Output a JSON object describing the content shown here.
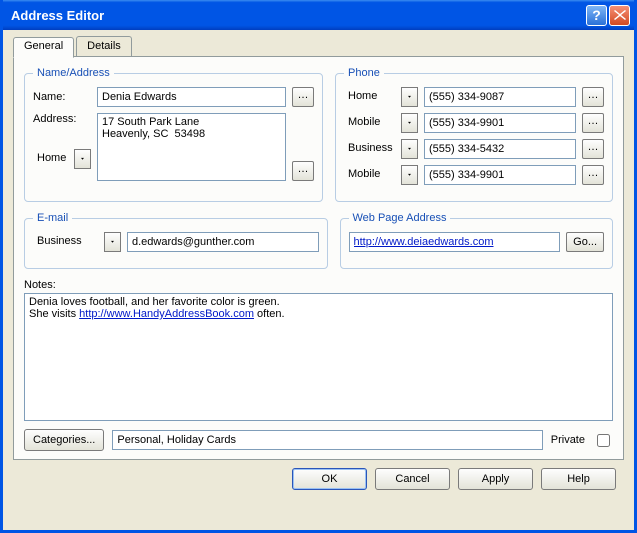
{
  "window": {
    "title": "Address Editor"
  },
  "tabs": {
    "general": "General",
    "details": "Details"
  },
  "groups": {
    "name_address": "Name/Address",
    "phone": "Phone",
    "email": "E-mail",
    "web": "Web Page Address"
  },
  "name_addr": {
    "name_label": "Name:",
    "name_value": "Denia Edwards",
    "address_label": "Address:",
    "address_value": "17 South Park Lane\nHeavenly, SC  53498",
    "addr_type": "Home"
  },
  "phones": [
    {
      "type": "Home",
      "number": "(555) 334-9087"
    },
    {
      "type": "Mobile",
      "number": "(555) 334-9901"
    },
    {
      "type": "Business",
      "number": "(555) 334-5432"
    },
    {
      "type": "Mobile",
      "number": "(555) 334-9901"
    }
  ],
  "email": {
    "type": "Business",
    "value": "d.edwards@gunther.com"
  },
  "web": {
    "url": "http://www.deiaedwards.com",
    "go_label": "Go..."
  },
  "notes": {
    "label": "Notes:",
    "text_pre": "Denia loves football, and her favorite color is green.\nShe visits ",
    "link_text": "http://www.HandyAddressBook.com",
    "text_post": " often."
  },
  "categories": {
    "button": "Categories...",
    "value": "Personal, Holiday Cards",
    "private_label": "Private"
  },
  "buttons": {
    "ok": "OK",
    "cancel": "Cancel",
    "apply": "Apply",
    "help": "Help"
  }
}
